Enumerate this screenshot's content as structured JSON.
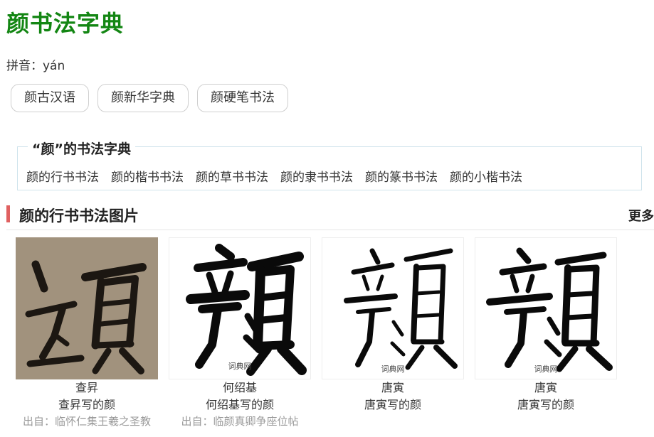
{
  "page": {
    "title": "颜书法字典",
    "pinyin": "拼音：yán"
  },
  "related_buttons": [
    "颜古汉语",
    "颜新华字典",
    "颜硬笔书法"
  ],
  "dictionary_panel": {
    "title": "“颜”的书法字典",
    "links": [
      "颜的行书书法",
      "颜的楷书书法",
      "颜的草书书法",
      "颜的隶书书法",
      "颜的篆书书法",
      "颜的小楷书法"
    ]
  },
  "section": {
    "title": "颜的行书书法图片",
    "more": "更多"
  },
  "cards": [
    {
      "author": "查昇",
      "caption": "查昇写的颜",
      "source": "出自：临怀仁集王羲之圣教",
      "watermark": ""
    },
    {
      "author": "何绍基",
      "caption": "何绍基写的颜",
      "source": "出自：临颜真卿争座位帖",
      "watermark": "词典网"
    },
    {
      "author": "唐寅",
      "caption": "唐寅写的颜",
      "source": "",
      "watermark": "词典网"
    },
    {
      "author": "唐寅",
      "caption": "唐寅写的颜",
      "source": "",
      "watermark": "词典网"
    }
  ],
  "colors": {
    "title_green": "#138613",
    "section_accent": "#e06060",
    "panel_border": "#cfe3ec",
    "card1_bg": "#a99a85"
  }
}
